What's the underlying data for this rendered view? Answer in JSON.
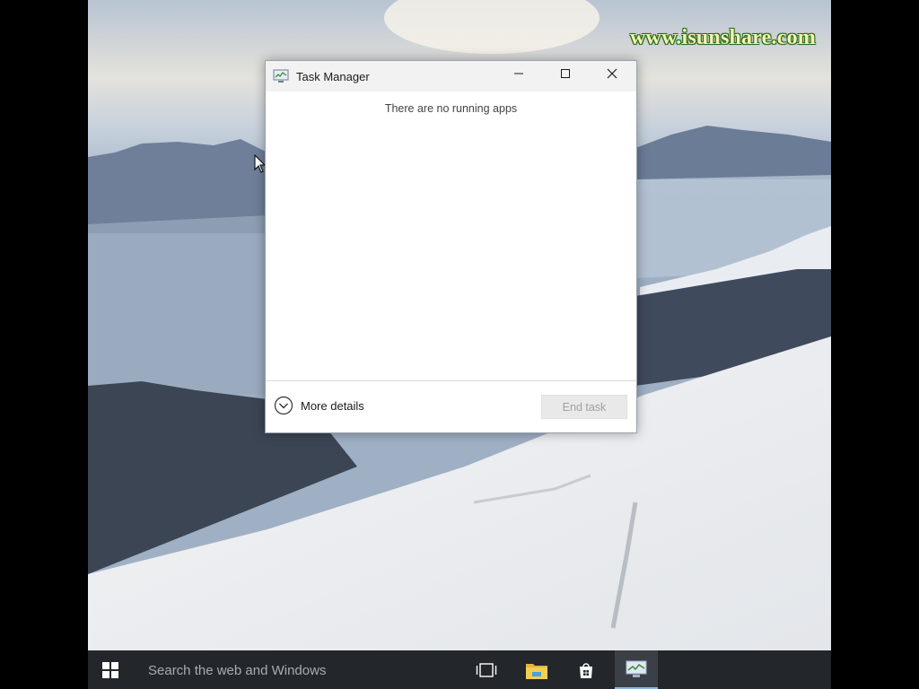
{
  "watermark": "www.isunshare.com",
  "window": {
    "title": "Task Manager",
    "app_icon": "task-manager-icon",
    "controls": [
      "minimize-icon",
      "maximize-icon",
      "close-icon"
    ],
    "message": "There are no running apps",
    "more_details_label": "More details",
    "end_task_label": "End task",
    "end_task_enabled": false
  },
  "taskbar": {
    "start_icon": "windows-logo-icon",
    "search_placeholder": "Search the web and Windows",
    "pinned": [
      {
        "name": "task-view",
        "icon": "task-view-icon"
      },
      {
        "name": "file-explorer",
        "icon": "folder-icon"
      },
      {
        "name": "store",
        "icon": "store-icon"
      },
      {
        "name": "task-manager",
        "icon": "task-manager-icon",
        "active": true
      }
    ]
  },
  "colors": {
    "taskbar": "#23272b",
    "titlebar": "#f2f2f2",
    "active_indicator": "#8fb4e3",
    "watermark_text": "#f6f3a8",
    "watermark_outline": "#2a6a2a"
  }
}
